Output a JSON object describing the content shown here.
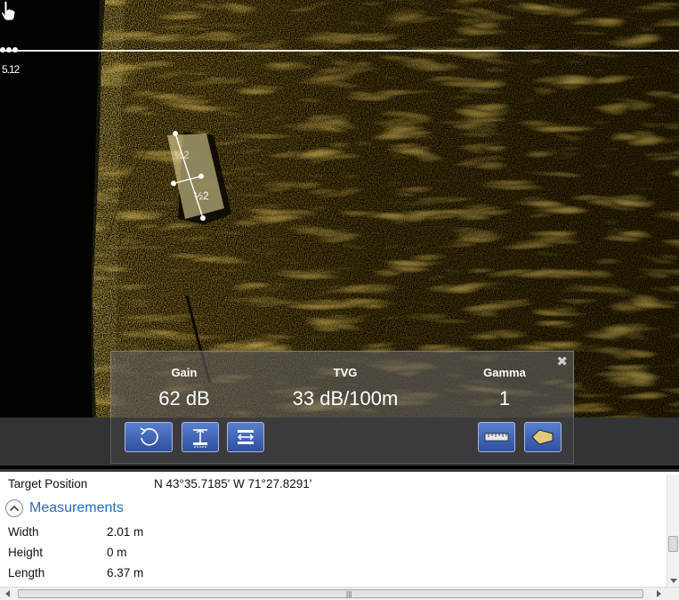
{
  "sonar": {
    "track_label": "5.12",
    "target_label_1": "½2",
    "target_label_2": "½2",
    "icons": [
      "pointer-hand-icon"
    ]
  },
  "adjust": {
    "gain_label": "Gain",
    "gain_value": "62 dB",
    "tvg_label": "TVG",
    "tvg_value": "33 dB/100m",
    "gamma_label": "Gamma",
    "gamma_value": "1",
    "close_label": "✖"
  },
  "toolbar": {
    "icons": [
      "undo-icon",
      "height-measure-icon",
      "width-measure-icon",
      "ruler-icon",
      "polygon-icon"
    ],
    "button_color": "#3f63b8"
  },
  "info": {
    "target_label": "Target Position",
    "target_value": "N 43°35.7185' W 71°27.8291'",
    "measurements_title": "Measurements",
    "rows": [
      {
        "label": "Width",
        "value": "2.01 m"
      },
      {
        "label": "Height",
        "value": "0 m"
      },
      {
        "label": "Length",
        "value": "6.37 m"
      }
    ]
  },
  "colors": {
    "sonar_gold": "#b8901e",
    "link_blue": "#2a6bbf",
    "toolbar_bg": "#333336"
  }
}
